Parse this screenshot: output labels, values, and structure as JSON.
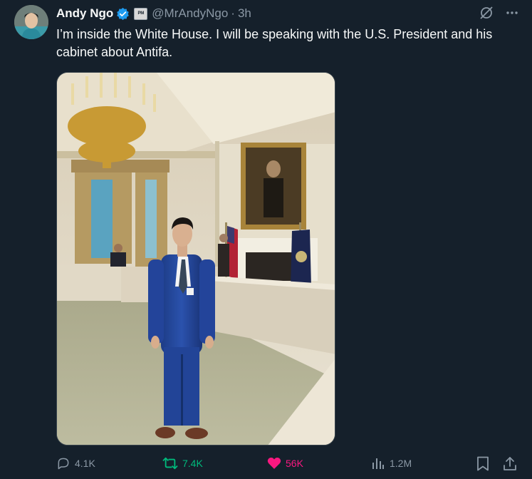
{
  "tweet": {
    "display_name": "Andy Ngo",
    "affiliation_badge": "PM",
    "handle": "@MrAndyNgo",
    "separator": "·",
    "time": "3h",
    "text": "I’m inside the White House. I will be speaking with the U.S. President and his cabinet about Antifa."
  },
  "actions": {
    "replies": "4.1K",
    "reposts": "7.4K",
    "likes": "56K",
    "views": "1.2M"
  },
  "colors": {
    "background": "#15202b",
    "verified": "#1d9bf0",
    "repost_active": "#00ba7c",
    "like_active": "#f91880",
    "muted_text": "#8b98a5"
  },
  "icons": [
    "verified-badge-icon",
    "grok-icon",
    "more-icon",
    "reply-icon",
    "repost-icon",
    "like-icon",
    "views-icon",
    "bookmark-icon",
    "share-icon"
  ]
}
